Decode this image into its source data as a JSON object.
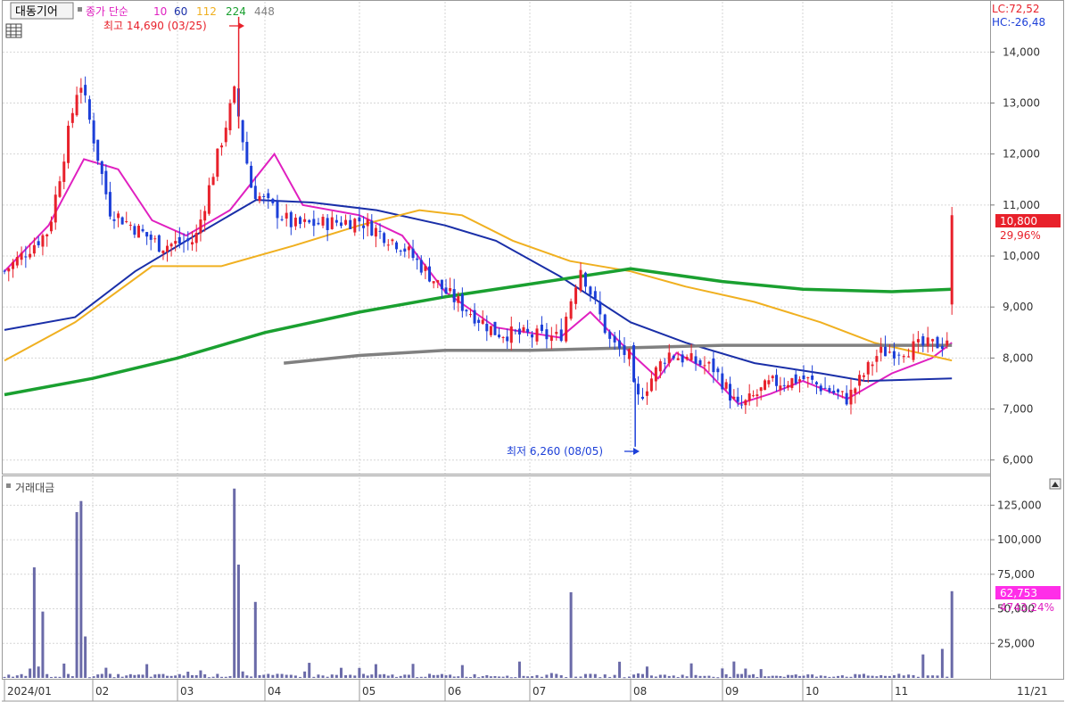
{
  "header": {
    "stock_name": "대동기어",
    "ma_title": "종가 단순",
    "ma_periods": [
      "10",
      "60",
      "112",
      "224",
      "448"
    ],
    "ma_colors": [
      "#e020c0",
      "#1a2fa8",
      "#f0b020",
      "#1aa030",
      "#808080"
    ],
    "lc_label": "LC:72,52",
    "hc_label": "HC:-26,48"
  },
  "annotations": {
    "high_label": "최고 14,690 (03/25)",
    "low_label": "최저 6,260 (08/05)"
  },
  "price_badge": {
    "value": "10,800",
    "change": "29,96%"
  },
  "volume_panel": {
    "title": "거래대금",
    "badge_value": "62,753",
    "badge_change": "4743,24%"
  },
  "x_axis": {
    "labels": [
      "2024/01",
      "02",
      "03",
      "04",
      "05",
      "06",
      "07",
      "08",
      "09",
      "10",
      "11"
    ],
    "right_label": "11/21"
  },
  "colors": {
    "up": "#e8212b",
    "down": "#1c3fd8",
    "volume": "#6a6aa8",
    "grid": "#d6d6d6"
  },
  "chart_data": [
    {
      "type": "candlestick",
      "title": "대동기어",
      "y_ticks": [
        "6,000",
        "7,000",
        "8,000",
        "9,000",
        "10,000",
        "11,000",
        "12,000",
        "13,000",
        "14,000"
      ],
      "ylim": [
        5750,
        14950
      ],
      "x_months": [
        "2024/01",
        "02",
        "03",
        "04",
        "05",
        "06",
        "07",
        "08",
        "09",
        "10",
        "11"
      ],
      "key_points": [
        {
          "month_pos": 0.0,
          "close": 9700
        },
        {
          "month_pos": 0.5,
          "close": 10500
        },
        {
          "month_pos": 0.85,
          "close": 13500
        },
        {
          "month_pos": 1.2,
          "close": 10900
        },
        {
          "month_pos": 1.8,
          "close": 10200
        },
        {
          "month_pos": 2.2,
          "close": 10300
        },
        {
          "month_pos": 2.65,
          "close": 13200
        },
        {
          "month_pos": 2.85,
          "close": 11300
        },
        {
          "month_pos": 3.3,
          "close": 10600
        },
        {
          "month_pos": 4.0,
          "close": 10700
        },
        {
          "month_pos": 4.5,
          "close": 10200
        },
        {
          "month_pos": 5.0,
          "close": 9300
        },
        {
          "month_pos": 5.6,
          "close": 8500
        },
        {
          "month_pos": 6.3,
          "close": 8400
        },
        {
          "month_pos": 6.5,
          "close": 9800
        },
        {
          "month_pos": 6.8,
          "close": 8300
        },
        {
          "month_pos": 7.0,
          "close": 8000
        },
        {
          "month_pos": 7.05,
          "close": 7100
        },
        {
          "month_pos": 7.4,
          "close": 8100
        },
        {
          "month_pos": 7.9,
          "close": 7800
        },
        {
          "month_pos": 8.2,
          "close": 7000
        },
        {
          "month_pos": 8.6,
          "close": 7500
        },
        {
          "month_pos": 9.0,
          "close": 7600
        },
        {
          "month_pos": 9.5,
          "close": 7200
        },
        {
          "month_pos": 9.85,
          "close": 8100
        },
        {
          "month_pos": 10.2,
          "close": 8200
        },
        {
          "month_pos": 10.55,
          "close": 8300
        },
        {
          "month_pos": 10.6,
          "close": 10800
        }
      ],
      "last_close": 10800,
      "high": {
        "value": 14690,
        "date": "03/25"
      },
      "low": {
        "value": 6260,
        "date": "08/05"
      },
      "moving_averages": [
        {
          "name": "10",
          "color": "#e020c0",
          "points": [
            [
              0,
              9700
            ],
            [
              0.5,
              10600
            ],
            [
              0.9,
              11900
            ],
            [
              1.3,
              11700
            ],
            [
              1.7,
              10700
            ],
            [
              2.1,
              10400
            ],
            [
              2.6,
              10900
            ],
            [
              3.1,
              12000
            ],
            [
              3.4,
              11000
            ],
            [
              4.0,
              10800
            ],
            [
              4.5,
              10400
            ],
            [
              5.0,
              9300
            ],
            [
              5.6,
              8600
            ],
            [
              6.3,
              8400
            ],
            [
              6.6,
              8900
            ],
            [
              7.0,
              8100
            ],
            [
              7.3,
              7600
            ],
            [
              7.5,
              8100
            ],
            [
              7.8,
              7800
            ],
            [
              8.2,
              7100
            ],
            [
              8.6,
              7300
            ],
            [
              9.0,
              7550
            ],
            [
              9.5,
              7200
            ],
            [
              10.0,
              7700
            ],
            [
              10.4,
              8000
            ],
            [
              10.6,
              8300
            ]
          ]
        },
        {
          "name": "60",
          "color": "#1a2fa8",
          "points": [
            [
              0,
              8550
            ],
            [
              0.8,
              8800
            ],
            [
              1.5,
              9700
            ],
            [
              2.2,
              10400
            ],
            [
              2.9,
              11100
            ],
            [
              3.5,
              11050
            ],
            [
              4.2,
              10900
            ],
            [
              5.0,
              10600
            ],
            [
              5.6,
              10300
            ],
            [
              6.3,
              9600
            ],
            [
              7.0,
              8700
            ],
            [
              7.6,
              8300
            ],
            [
              8.4,
              7900
            ],
            [
              9.2,
              7700
            ],
            [
              9.7,
              7550
            ],
            [
              10.6,
              7600
            ]
          ]
        },
        {
          "name": "112",
          "color": "#f0b020",
          "points": [
            [
              0,
              7950
            ],
            [
              0.8,
              8700
            ],
            [
              1.7,
              9800
            ],
            [
              2.5,
              9800
            ],
            [
              3.3,
              10200
            ],
            [
              4.0,
              10600
            ],
            [
              4.7,
              10900
            ],
            [
              5.2,
              10800
            ],
            [
              5.8,
              10300
            ],
            [
              6.4,
              9900
            ],
            [
              7.0,
              9700
            ],
            [
              7.6,
              9400
            ],
            [
              8.4,
              9100
            ],
            [
              9.2,
              8700
            ],
            [
              9.8,
              8300
            ],
            [
              10.6,
              7950
            ]
          ]
        },
        {
          "name": "224",
          "color": "#1aa030",
          "points": [
            [
              0,
              7280
            ],
            [
              1.0,
              7600
            ],
            [
              2.0,
              8000
            ],
            [
              3.0,
              8500
            ],
            [
              4.0,
              8900
            ],
            [
              5.0,
              9200
            ],
            [
              6.0,
              9450
            ],
            [
              7.0,
              9750
            ],
            [
              8.0,
              9500
            ],
            [
              9.0,
              9350
            ],
            [
              10.0,
              9300
            ],
            [
              10.6,
              9350
            ]
          ]
        },
        {
          "name": "448",
          "color": "#808080",
          "points": [
            [
              3.2,
              7900
            ],
            [
              4.0,
              8050
            ],
            [
              5.0,
              8150
            ],
            [
              6.0,
              8150
            ],
            [
              7.0,
              8200
            ],
            [
              8.0,
              8250
            ],
            [
              9.0,
              8250
            ],
            [
              10.0,
              8250
            ],
            [
              10.6,
              8250
            ]
          ]
        }
      ]
    },
    {
      "type": "bar",
      "title": "거래대금",
      "y_ticks": [
        "25,000",
        "50,000",
        "75,000",
        "100,000",
        "125,000"
      ],
      "ylim": [
        0,
        142000
      ],
      "spikes": [
        {
          "month_pos": 0.35,
          "value": 80000
        },
        {
          "month_pos": 0.45,
          "value": 48000
        },
        {
          "month_pos": 0.8,
          "value": 120000
        },
        {
          "month_pos": 0.85,
          "value": 128000
        },
        {
          "month_pos": 0.9,
          "value": 30000
        },
        {
          "month_pos": 2.65,
          "value": 137000
        },
        {
          "month_pos": 2.7,
          "value": 82000
        },
        {
          "month_pos": 2.9,
          "value": 55000
        },
        {
          "month_pos": 6.4,
          "value": 62000
        },
        {
          "month_pos": 10.3,
          "value": 17000
        },
        {
          "month_pos": 10.5,
          "value": 21000
        },
        {
          "month_pos": 10.6,
          "value": 62753
        }
      ],
      "last_value": 62753
    }
  ]
}
